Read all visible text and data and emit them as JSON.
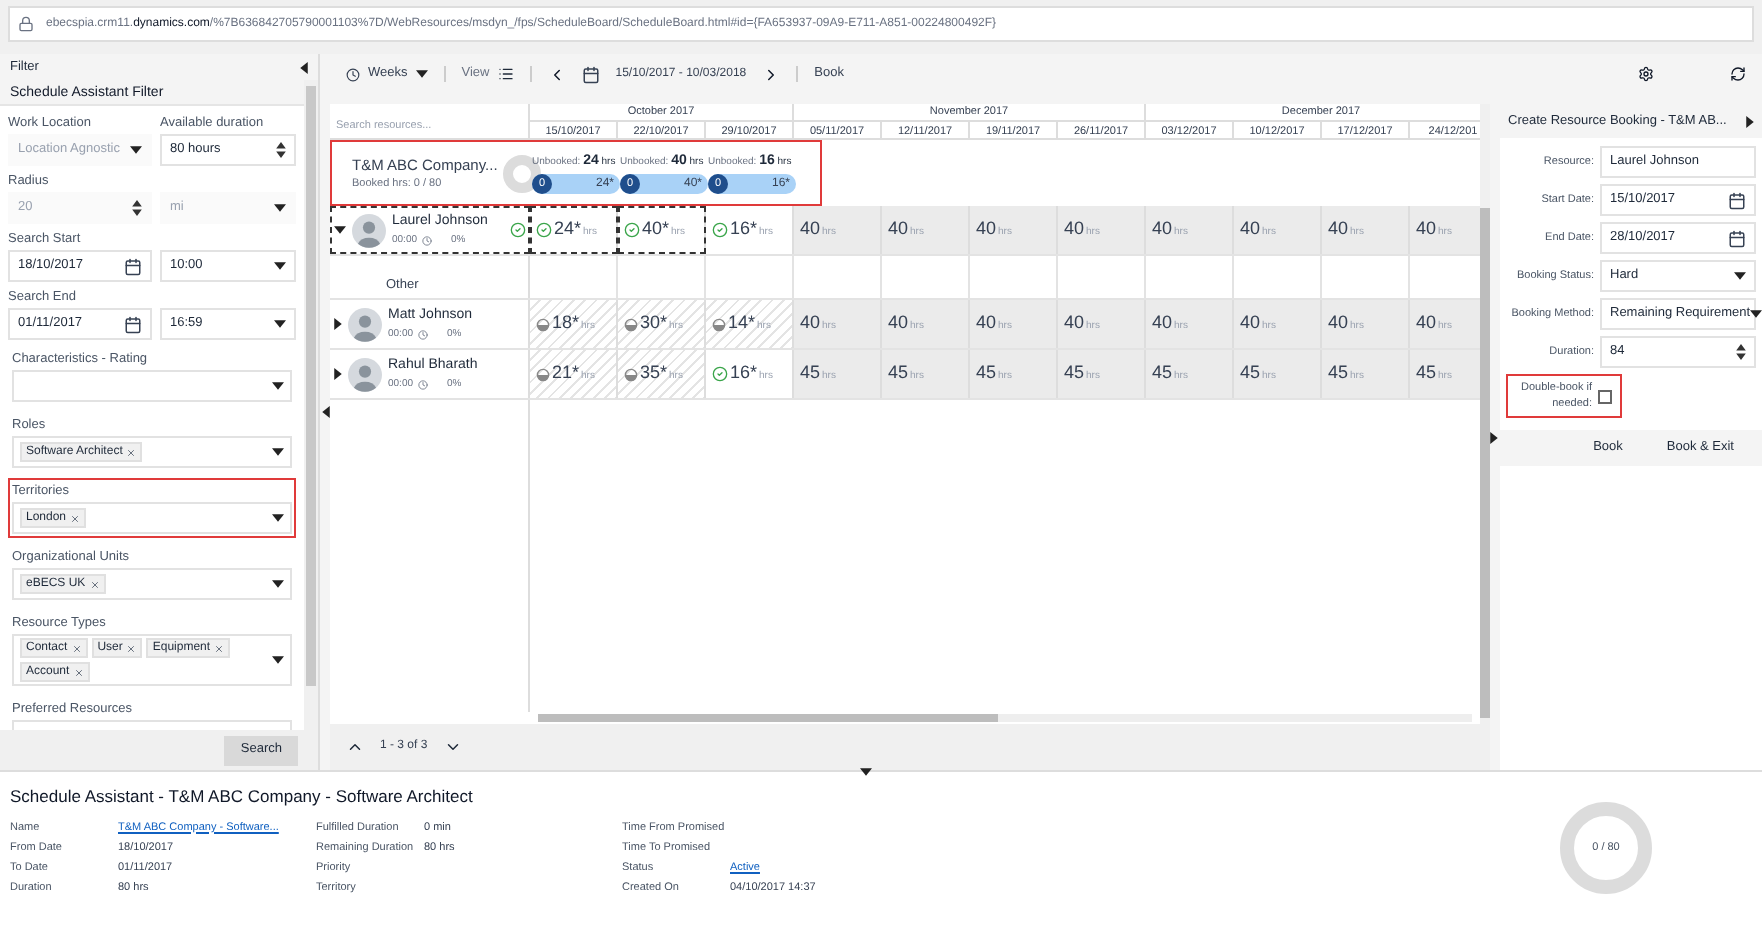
{
  "address_bar": {
    "host_prefix": "ebecspia.crm11.",
    "host_domain": "dynamics.com",
    "path": "/%7B636842705790001103%7D/WebResources/msdyn_/fps/ScheduleBoard/ScheduleBoard.html#id={FA653937-09A9-E711-A851-00224800492F}"
  },
  "filter": {
    "header": "Filter",
    "title": "Schedule Assistant Filter",
    "search_button": "Search",
    "rows": [
      {
        "kind": "split",
        "fields": [
          {
            "label": "Work Location",
            "value": "Location Agnostic",
            "kind": "dropdown",
            "disabled": true
          },
          {
            "label": "Available duration",
            "value": "80 hours",
            "kind": "spinner",
            "disabled": false
          }
        ]
      },
      {
        "kind": "split",
        "fields": [
          {
            "label": "Radius",
            "value": "20",
            "kind": "spinner",
            "disabled": true
          },
          {
            "value": "mi",
            "kind": "dropdown",
            "disabled": true
          }
        ]
      },
      {
        "kind": "split",
        "fields": [
          {
            "label": "Search Start",
            "value": "18/10/2017",
            "kind": "calendar",
            "disabled": false
          },
          {
            "value": "10:00",
            "kind": "dropdown",
            "disabled": false
          }
        ]
      },
      {
        "kind": "split",
        "fields": [
          {
            "label": "Search End",
            "value": "01/11/2017",
            "kind": "calendar",
            "disabled": false
          },
          {
            "value": "16:59",
            "kind": "dropdown",
            "disabled": false
          }
        ]
      },
      {
        "kind": "tags",
        "label": "Characteristics - Rating",
        "highlighted": false
      },
      {
        "kind": "tags",
        "label": "Roles",
        "tags": [
          "Software Architect"
        ],
        "highlighted": false
      },
      {
        "kind": "tags",
        "label": "Territories",
        "tags": [
          "London"
        ],
        "highlighted": true
      },
      {
        "kind": "tags",
        "label": "Organizational Units",
        "tags": [
          "eBECS UK"
        ],
        "highlighted": false
      },
      {
        "kind": "tags",
        "label": "Resource Types",
        "tags": [
          "Contact",
          "User",
          "Equipment",
          "Account"
        ],
        "highlighted": false
      },
      {
        "kind": "tags",
        "label": "Preferred Resources",
        "highlighted": false
      }
    ]
  },
  "toolbar": {
    "period": "Weeks",
    "view": "View",
    "date_range": "15/10/2017 - 10/03/2018",
    "book": "Book"
  },
  "board": {
    "search_placeholder": "Search resources...",
    "months": [
      {
        "label": "October 2017",
        "weeks": [
          "15/10/2017",
          "22/10/2017",
          "29/10/2017"
        ]
      },
      {
        "label": "November 2017",
        "weeks": [
          "05/11/2017",
          "12/11/2017",
          "19/11/2017",
          "26/11/2017"
        ]
      },
      {
        "label": "December 2017",
        "weeks": [
          "03/12/2017",
          "10/12/2017",
          "17/12/2017",
          "24/12/201"
        ]
      }
    ],
    "requirement": {
      "name": "T&M ABC Company...",
      "booked": "Booked hrs: 0 / 80",
      "highlighted": true,
      "segments": [
        {
          "label": "Unbooked:",
          "hours": "24",
          "unit": "hrs",
          "booked": "0",
          "remaining": "24*"
        },
        {
          "label": "Unbooked:",
          "hours": "40",
          "unit": "hrs",
          "booked": "0",
          "remaining": "40*"
        },
        {
          "label": "Unbooked:",
          "hours": "16",
          "unit": "hrs",
          "booked": "0",
          "remaining": "16*"
        }
      ]
    },
    "resources": [
      {
        "name": "Laurel Johnson",
        "time": "00:00",
        "percent": "0%",
        "expanded": true,
        "selected": true,
        "match": true,
        "children": [
          {
            "name": "Other"
          }
        ],
        "cells": [
          {
            "hours": "24*",
            "unit": "hrs",
            "kind": "match",
            "selected": true
          },
          {
            "hours": "40*",
            "unit": "hrs",
            "kind": "match",
            "selected": true
          },
          {
            "hours": "16*",
            "unit": "hrs",
            "kind": "match",
            "selected": false
          },
          {
            "hours": "40",
            "unit": "hrs",
            "kind": "capacity",
            "selected": false
          },
          {
            "hours": "40",
            "unit": "hrs",
            "kind": "capacity",
            "selected": false
          },
          {
            "hours": "40",
            "unit": "hrs",
            "kind": "capacity",
            "selected": false
          },
          {
            "hours": "40",
            "unit": "hrs",
            "kind": "capacity",
            "selected": false
          },
          {
            "hours": "40",
            "unit": "hrs",
            "kind": "capacity",
            "selected": false
          },
          {
            "hours": "40",
            "unit": "hrs",
            "kind": "capacity",
            "selected": false
          },
          {
            "hours": "40",
            "unit": "hrs",
            "kind": "capacity",
            "selected": false
          },
          {
            "hours": "40",
            "unit": "hrs",
            "kind": "capacity",
            "selected": false
          }
        ]
      },
      {
        "name": "Matt Johnson",
        "time": "00:00",
        "percent": "0%",
        "expanded": false,
        "selected": false,
        "match": false,
        "cells": [
          {
            "hours": "18*",
            "unit": "hrs",
            "kind": "partial",
            "selected": false
          },
          {
            "hours": "30*",
            "unit": "hrs",
            "kind": "partial",
            "selected": false
          },
          {
            "hours": "14*",
            "unit": "hrs",
            "kind": "partial",
            "selected": false
          },
          {
            "hours": "40",
            "unit": "hrs",
            "kind": "capacity",
            "selected": false
          },
          {
            "hours": "40",
            "unit": "hrs",
            "kind": "capacity",
            "selected": false
          },
          {
            "hours": "40",
            "unit": "hrs",
            "kind": "capacity",
            "selected": false
          },
          {
            "hours": "40",
            "unit": "hrs",
            "kind": "capacity",
            "selected": false
          },
          {
            "hours": "40",
            "unit": "hrs",
            "kind": "capacity",
            "selected": false
          },
          {
            "hours": "40",
            "unit": "hrs",
            "kind": "capacity",
            "selected": false
          },
          {
            "hours": "40",
            "unit": "hrs",
            "kind": "capacity",
            "selected": false
          },
          {
            "hours": "40",
            "unit": "hrs",
            "kind": "capacity",
            "selected": false
          }
        ]
      },
      {
        "name": "Rahul Bharath",
        "time": "00:00",
        "percent": "0%",
        "expanded": false,
        "selected": false,
        "match": false,
        "cells": [
          {
            "hours": "21*",
            "unit": "hrs",
            "kind": "partial",
            "selected": false
          },
          {
            "hours": "35*",
            "unit": "hrs",
            "kind": "partial",
            "selected": false
          },
          {
            "hours": "16*",
            "unit": "hrs",
            "kind": "match",
            "selected": false
          },
          {
            "hours": "45",
            "unit": "hrs",
            "kind": "capacity",
            "selected": false
          },
          {
            "hours": "45",
            "unit": "hrs",
            "kind": "capacity",
            "selected": false
          },
          {
            "hours": "45",
            "unit": "hrs",
            "kind": "capacity",
            "selected": false
          },
          {
            "hours": "45",
            "unit": "hrs",
            "kind": "capacity",
            "selected": false
          },
          {
            "hours": "45",
            "unit": "hrs",
            "kind": "capacity",
            "selected": false
          },
          {
            "hours": "45",
            "unit": "hrs",
            "kind": "capacity",
            "selected": false
          },
          {
            "hours": "45",
            "unit": "hrs",
            "kind": "capacity",
            "selected": false
          },
          {
            "hours": "45",
            "unit": "hrs",
            "kind": "capacity",
            "selected": false
          }
        ]
      }
    ],
    "paging": "1 - 3 of 3"
  },
  "booking": {
    "title": "Create Resource Booking - T&M AB...",
    "fields": [
      {
        "label": "Resource:",
        "value": "Laurel Johnson",
        "kind": "text"
      },
      {
        "label": "Start Date:",
        "value": "15/10/2017",
        "kind": "calendar"
      },
      {
        "label": "End Date:",
        "value": "28/10/2017",
        "kind": "calendar"
      },
      {
        "label": "Booking Status:",
        "value": "Hard",
        "kind": "dropdown"
      },
      {
        "label": "Booking Method:",
        "value": "Remaining Requirement",
        "kind": "dropdown"
      },
      {
        "label": "Duration:",
        "value": "84",
        "kind": "spinner"
      }
    ],
    "double_book": {
      "label": "Double-book if needed:",
      "checked": false,
      "highlighted": true
    },
    "buttons": [
      "Book",
      "Book & Exit"
    ]
  },
  "details": {
    "title": "Schedule Assistant - T&M ABC Company - Software Architect",
    "columns": [
      [
        {
          "label": "Name",
          "value": "T&M ABC Company - Software...",
          "link": true
        },
        {
          "label": "From Date",
          "value": "18/10/2017",
          "link": false
        },
        {
          "label": "To Date",
          "value": "01/11/2017",
          "link": false
        },
        {
          "label": "Duration",
          "value": "80 hrs",
          "link": false
        }
      ],
      [
        {
          "label": "Fulfilled Duration",
          "value": "0 min",
          "link": false
        },
        {
          "label": "Remaining Duration",
          "value": "80 hrs",
          "link": false
        },
        {
          "label": "Priority"
        },
        {
          "label": "Territory"
        }
      ],
      [
        {
          "label": "Time From Promised"
        },
        {
          "label": "Time To Promised"
        },
        {
          "label": "Status",
          "value": "Active",
          "link": true
        },
        {
          "label": "Created On",
          "value": "04/10/2017 14:37",
          "link": false
        }
      ]
    ],
    "donut_label": "0 / 80"
  }
}
